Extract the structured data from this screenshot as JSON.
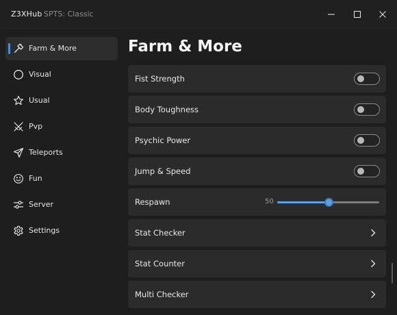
{
  "window": {
    "title": "Z3XHub",
    "subtitle": "SPTS: Classic",
    "controls": [
      "minimize-icon",
      "maximize-icon",
      "close-icon"
    ]
  },
  "sidebar": {
    "items": [
      {
        "label": "Farm & More",
        "icon": "hammer-icon",
        "active": true
      },
      {
        "label": "Visual",
        "icon": "circle-icon",
        "active": false
      },
      {
        "label": "Usual",
        "icon": "star-icon",
        "active": false
      },
      {
        "label": "Pvp",
        "icon": "swords-icon",
        "active": false
      },
      {
        "label": "Teleports",
        "icon": "send-icon",
        "active": false
      },
      {
        "label": "Fun",
        "icon": "smile-icon",
        "active": false
      },
      {
        "label": "Server",
        "icon": "sliders-icon",
        "active": false
      },
      {
        "label": "Settings",
        "icon": "gear-icon",
        "active": false
      }
    ]
  },
  "main": {
    "title": "Farm & More",
    "rows": [
      {
        "type": "toggle",
        "label": "Fist Strength",
        "on": false
      },
      {
        "type": "toggle",
        "label": "Body Toughness",
        "on": false
      },
      {
        "type": "toggle",
        "label": "Psychic Power",
        "on": false
      },
      {
        "type": "toggle",
        "label": "Jump & Speed",
        "on": false
      },
      {
        "type": "slider",
        "label": "Respawn",
        "value": "50",
        "level": 0.5
      },
      {
        "type": "link",
        "label": "Stat Checker"
      },
      {
        "type": "link",
        "label": "Stat Counter"
      },
      {
        "type": "link",
        "label": "Multi Checker"
      }
    ]
  },
  "colors": {
    "accent": "#5aa0e6",
    "background": "#1e1e1e",
    "row_background": "#2b2b2b"
  }
}
